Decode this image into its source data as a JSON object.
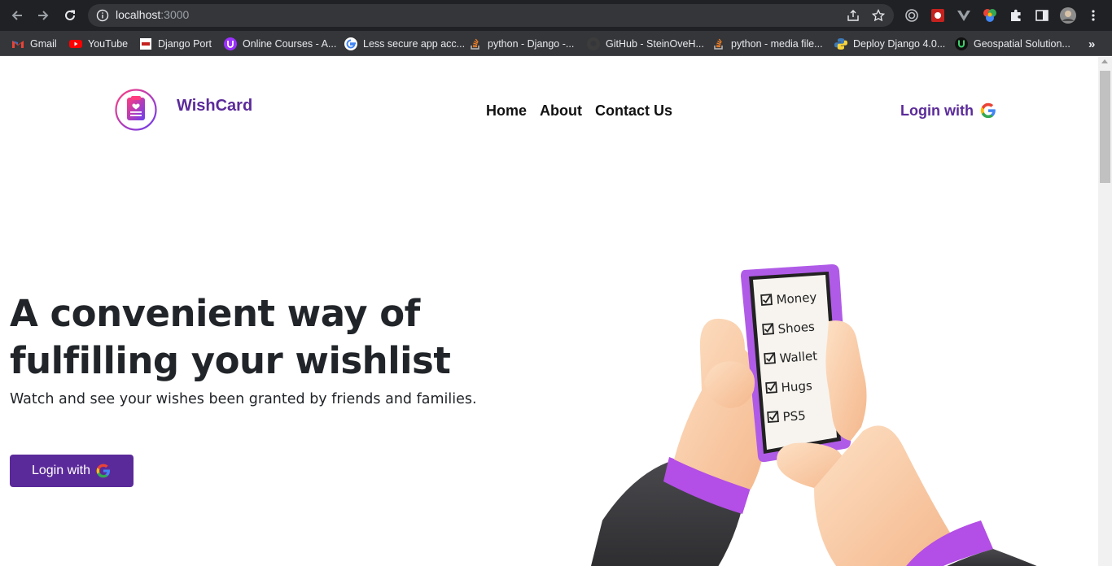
{
  "browser": {
    "url_host": "localhost",
    "url_port": ":3000",
    "bookmarks": [
      {
        "label": "Gmail",
        "icon": "gmail-icon"
      },
      {
        "label": "YouTube",
        "icon": "youtube-icon"
      },
      {
        "label": "Django Port",
        "icon": "django-port-icon"
      },
      {
        "label": "Online Courses - A...",
        "icon": "online-courses-icon"
      },
      {
        "label": "Less secure app acc...",
        "icon": "google-icon"
      },
      {
        "label": "python - Django -...",
        "icon": "stackoverflow-icon"
      },
      {
        "label": "GitHub - SteinOveH...",
        "icon": "github-icon"
      },
      {
        "label": "python - media file...",
        "icon": "stackoverflow-icon"
      },
      {
        "label": "Deploy Django 4.0...",
        "icon": "python-icon"
      },
      {
        "label": "Geospatial Solution...",
        "icon": "geospatial-icon"
      }
    ],
    "more_bookmarks": "»"
  },
  "header": {
    "brand": "WishCard",
    "nav": {
      "home": "Home",
      "about": "About",
      "contact": "Contact Us"
    },
    "login_label": "Login with"
  },
  "hero": {
    "title_line1": "A convenient way of",
    "title_line2": "fulfilling your wishlist",
    "subtitle": "Watch and see your wishes been granted by friends and families.",
    "cta_label": "Login with"
  },
  "illustration": {
    "checklist": [
      "Money",
      "Shoes",
      "Wallet",
      "Hugs",
      "PS5"
    ]
  },
  "colors": {
    "brand_purple": "#5b2a9a",
    "chrome_dark": "#202124",
    "google_blue": "#4285F4",
    "google_red": "#EA4335",
    "google_yellow": "#FBBC05",
    "google_green": "#34A853"
  }
}
